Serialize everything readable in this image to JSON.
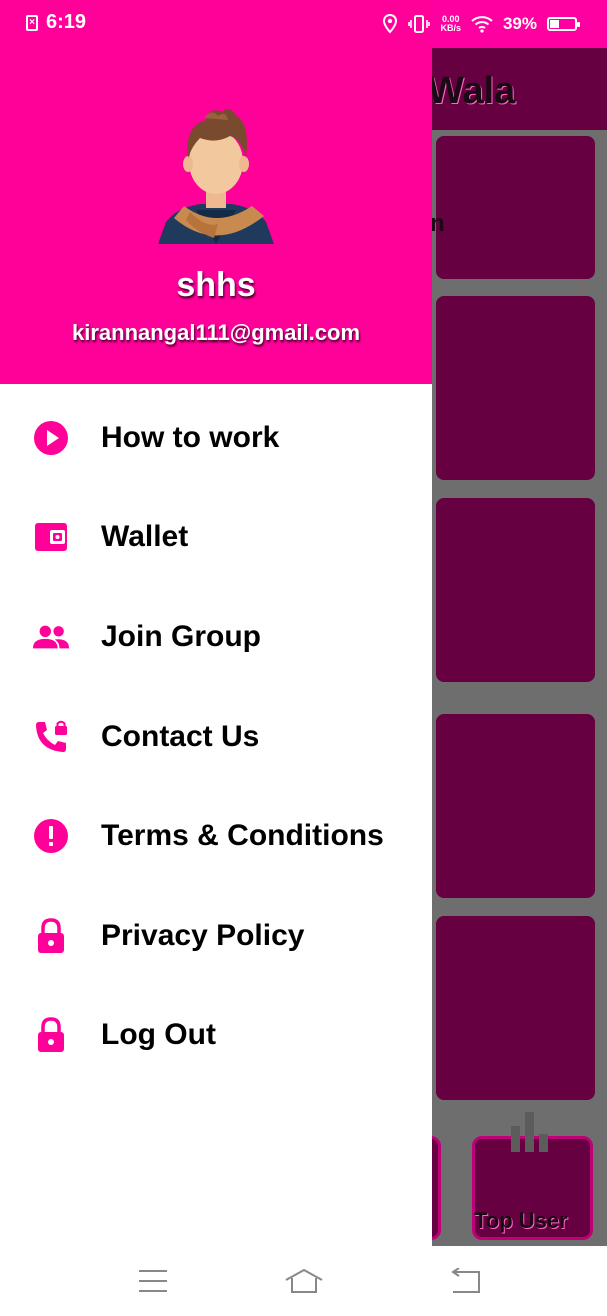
{
  "status_bar": {
    "time": "6:19",
    "sim_icon": "sim-off-icon",
    "net_speed_value": "0.00",
    "net_speed_unit": "KB/s",
    "battery_percent": "39%",
    "battery_level": 0.39
  },
  "background_app": {
    "title_fragment": "Wala",
    "card_text_fragment": "n",
    "tile_label": "Top User"
  },
  "drawer": {
    "user_name": "shhs",
    "user_email": "kirannangal111@gmail.com",
    "accent_color": "#ff0099",
    "items": [
      {
        "label": "How to work",
        "icon": "play-circle-icon"
      },
      {
        "label": "Wallet",
        "icon": "wallet-icon"
      },
      {
        "label": "Join Group",
        "icon": "group-icon"
      },
      {
        "label": "Contact Us",
        "icon": "phone-lock-icon"
      },
      {
        "label": "Terms & Conditions",
        "icon": "alert-circle-icon"
      },
      {
        "label": "Privacy Policy",
        "icon": "lock-icon"
      },
      {
        "label": "Log Out",
        "icon": "lock-icon"
      }
    ]
  },
  "nav_bar": {
    "menu_icon": "menu-icon",
    "home_icon": "home-icon",
    "back_icon": "back-icon"
  }
}
